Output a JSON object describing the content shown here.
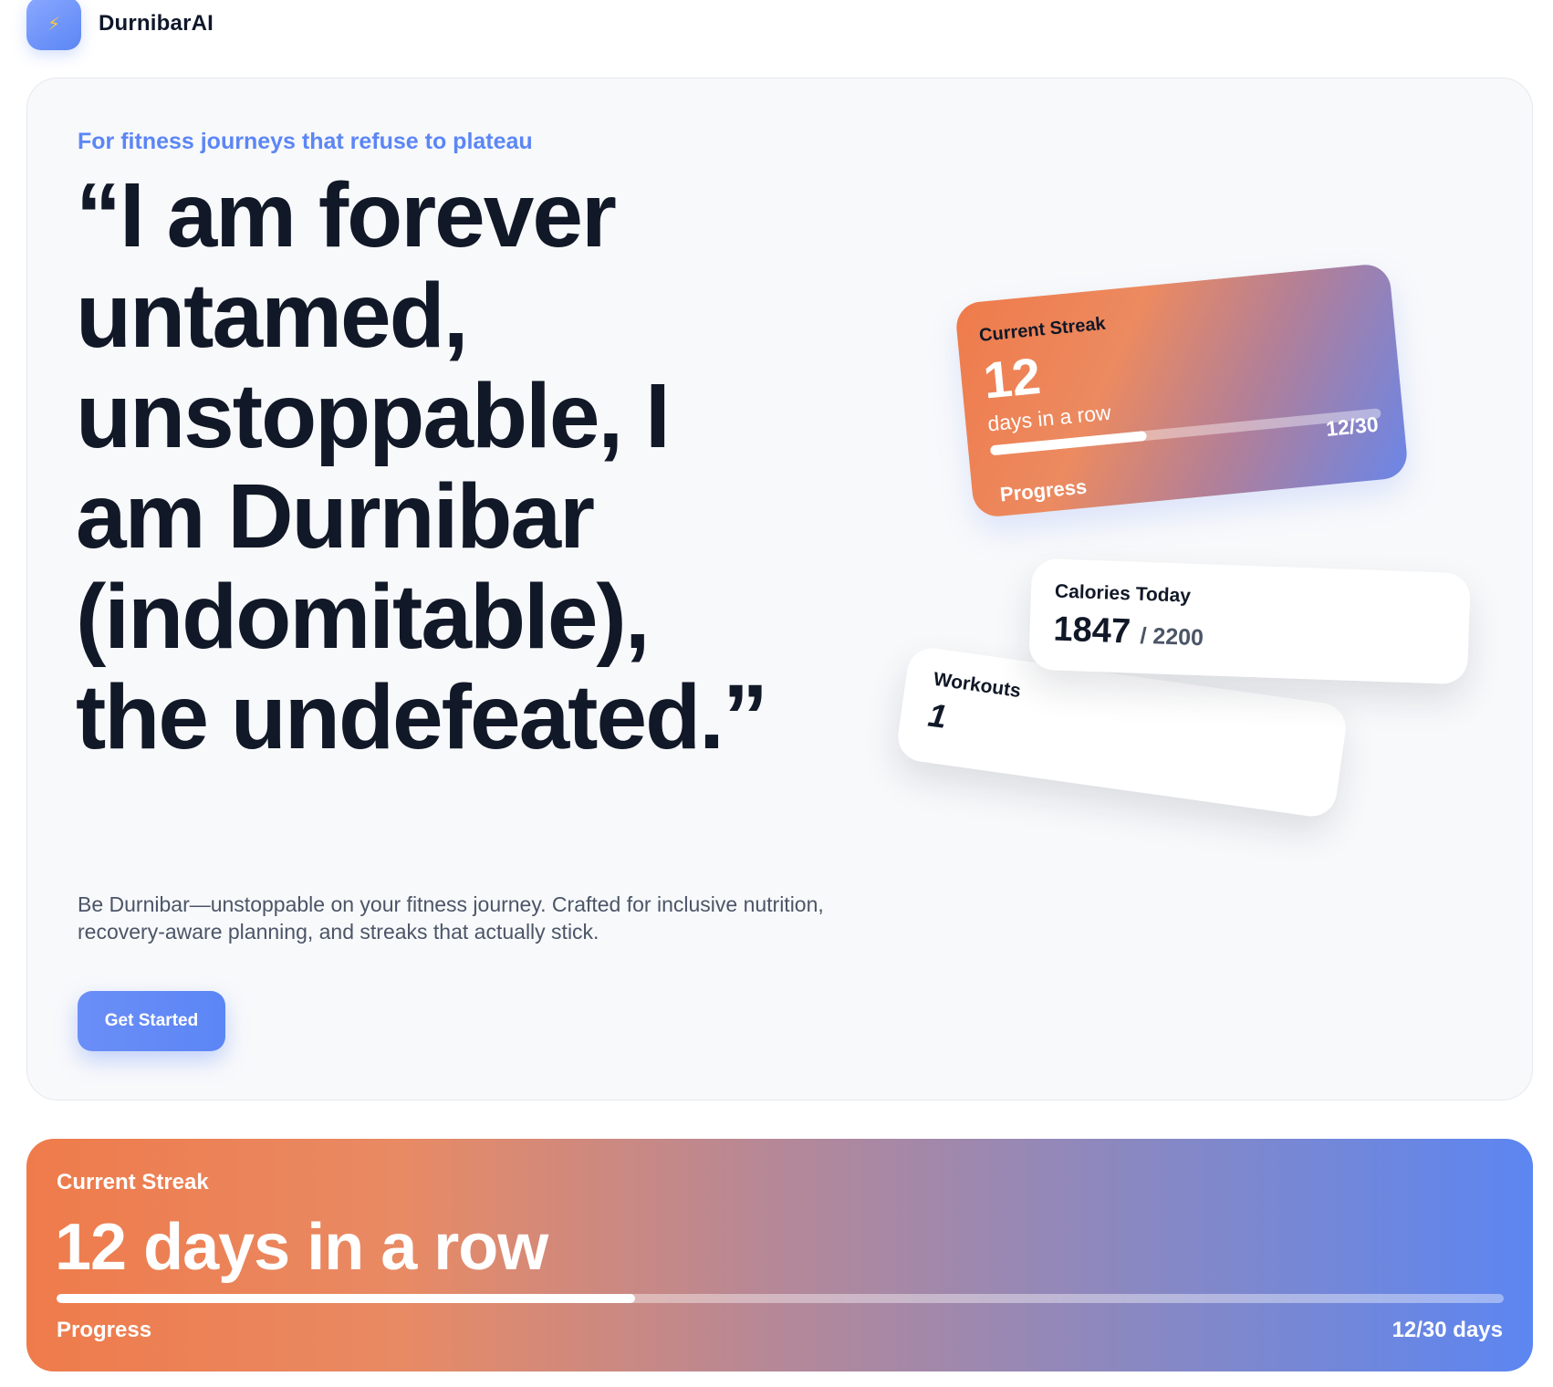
{
  "header": {
    "logo_icon": "lightning-bolt-icon",
    "logo_glyph": "⚡",
    "brand": "DurnibarAI"
  },
  "hero": {
    "eyebrow": "For fitness journeys that refuse to plateau",
    "headline": "“I am forever untamed, unstoppable, I am Durnibar (indomitable), the undefeated.”",
    "subtext": "Be Durnibar—unstoppable on your fitness journey. Crafted for inclusive nutrition, recovery-aware planning, and streaks that actually stick.",
    "cta_label": "Get Started"
  },
  "cards": {
    "streak": {
      "label": "Current Streak",
      "value": "12",
      "unit": "days in a row",
      "progress_text": "12/30",
      "progress_label": "Progress",
      "progress_fraction": 0.4
    },
    "calories": {
      "label": "Calories Today",
      "value": "1847",
      "goal": "/ 2200"
    },
    "workouts": {
      "label": "Workouts",
      "value": "1"
    }
  },
  "banner": {
    "label": "Current Streak",
    "headline": "12 days in a row",
    "progress_label": "Progress",
    "progress_text": "12/30 days",
    "progress_fraction": 0.4
  },
  "colors": {
    "accent": "#5b86f5",
    "streak_orange": "#ef7b4b",
    "text_dark": "#111827",
    "text_muted": "#4b5567"
  }
}
